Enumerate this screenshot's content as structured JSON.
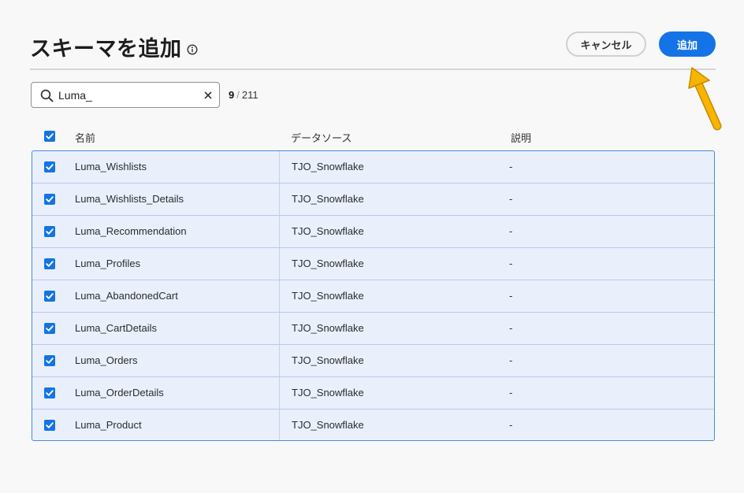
{
  "dialog": {
    "title": "スキーマを追加",
    "cancel_label": "キャンセル",
    "add_label": "追加"
  },
  "search": {
    "value": "Luma_",
    "selected_count": "9",
    "total_count": "211"
  },
  "table": {
    "columns": [
      "名前",
      "データソース",
      "説明"
    ],
    "rows": [
      {
        "name": "Luma_Wishlists",
        "source": "TJO_Snowflake",
        "description": "-"
      },
      {
        "name": "Luma_Wishlists_Details",
        "source": "TJO_Snowflake",
        "description": "-"
      },
      {
        "name": "Luma_Recommendation",
        "source": "TJO_Snowflake",
        "description": "-"
      },
      {
        "name": "Luma_Profiles",
        "source": "TJO_Snowflake",
        "description": "-"
      },
      {
        "name": "Luma_AbandonedCart",
        "source": "TJO_Snowflake",
        "description": "-"
      },
      {
        "name": "Luma_CartDetails",
        "source": "TJO_Snowflake",
        "description": "-"
      },
      {
        "name": "Luma_Orders",
        "source": "TJO_Snowflake",
        "description": "-"
      },
      {
        "name": "Luma_OrderDetails",
        "source": "TJO_Snowflake",
        "description": "-"
      },
      {
        "name": "Luma_Product",
        "source": "TJO_Snowflake",
        "description": "-"
      }
    ]
  },
  "colors": {
    "accent": "#1473e6",
    "selected_row_bg": "#e9f0fc",
    "annotation_arrow": "#f5b400"
  },
  "icons": [
    "info-icon",
    "search-icon",
    "clear-icon",
    "checkbox-checked-icon",
    "arrow-annotation"
  ]
}
